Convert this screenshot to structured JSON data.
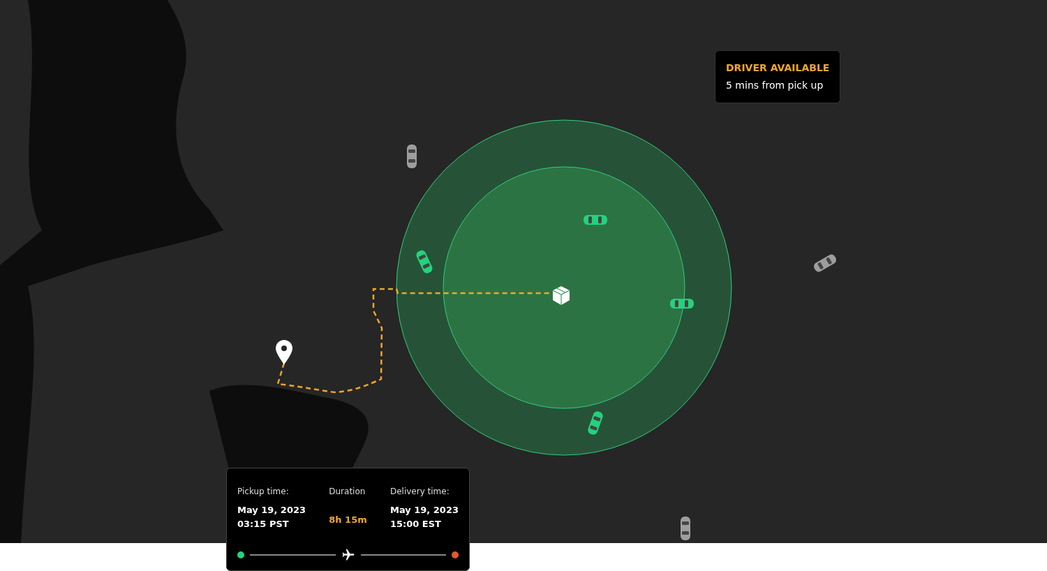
{
  "map": {
    "cars": [
      {
        "color": "#9e9e9e"
      },
      {
        "color": "#22d37c"
      },
      {
        "color": "#22d37c"
      },
      {
        "color": "#22d37c"
      },
      {
        "color": "#22d37c"
      },
      {
        "color": "#9e9e9e"
      },
      {
        "color": "#9e9e9e"
      }
    ]
  },
  "driver_status": {
    "title": "DRIVER AVAILABLE",
    "subtitle": "5 mins from pick up"
  },
  "trip": {
    "pickup": {
      "label": "Pickup time:",
      "date": "May 19, 2023",
      "time": "03:15 PST"
    },
    "duration": {
      "label": "Duration",
      "value": "8h 15m"
    },
    "delivery": {
      "label": "Delivery time:",
      "date": "May 19, 2023",
      "time": "15:00 EST"
    }
  }
}
